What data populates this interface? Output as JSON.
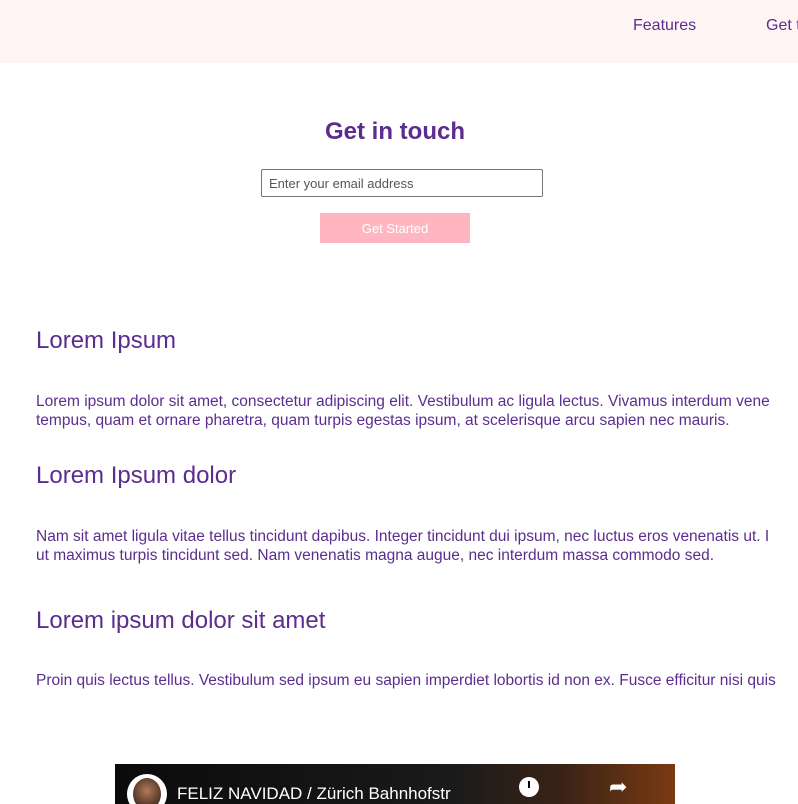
{
  "nav": {
    "features_label": "Features",
    "get_label": "Get t"
  },
  "hero": {
    "title": "Get in touch",
    "email_placeholder": "Enter your email address",
    "cta_label": "Get Started"
  },
  "sections": [
    {
      "heading": "Lorem Ipsum",
      "line1": "Lorem ipsum dolor sit amet, consectetur adipiscing elit. Vestibulum ac ligula lectus. Vivamus interdum vene",
      "line2": "tempus, quam et ornare pharetra, quam turpis egestas ipsum, at scelerisque arcu sapien nec mauris."
    },
    {
      "heading": "Lorem Ipsum dolor",
      "line1": "Nam sit amet ligula vitae tellus tincidunt dapibus. Integer tincidunt dui ipsum, nec luctus eros venenatis ut. I",
      "line2": "ut maximus turpis tincidunt sed. Nam venenatis magna augue, nec interdum massa commodo sed."
    },
    {
      "heading": "Lorem ipsum dolor sit amet",
      "line1": "Proin quis lectus tellus. Vestibulum sed ipsum eu sapien imperdiet lobortis id non ex. Fusce efficitur nisi quis"
    }
  ],
  "video": {
    "title": "FELIZ NAVIDAD / Zürich Bahnhofstr"
  },
  "colors": {
    "accent": "#5b2d8e",
    "topbar_bg": "#fff5f5",
    "cta_bg": "#ffb6c1"
  }
}
